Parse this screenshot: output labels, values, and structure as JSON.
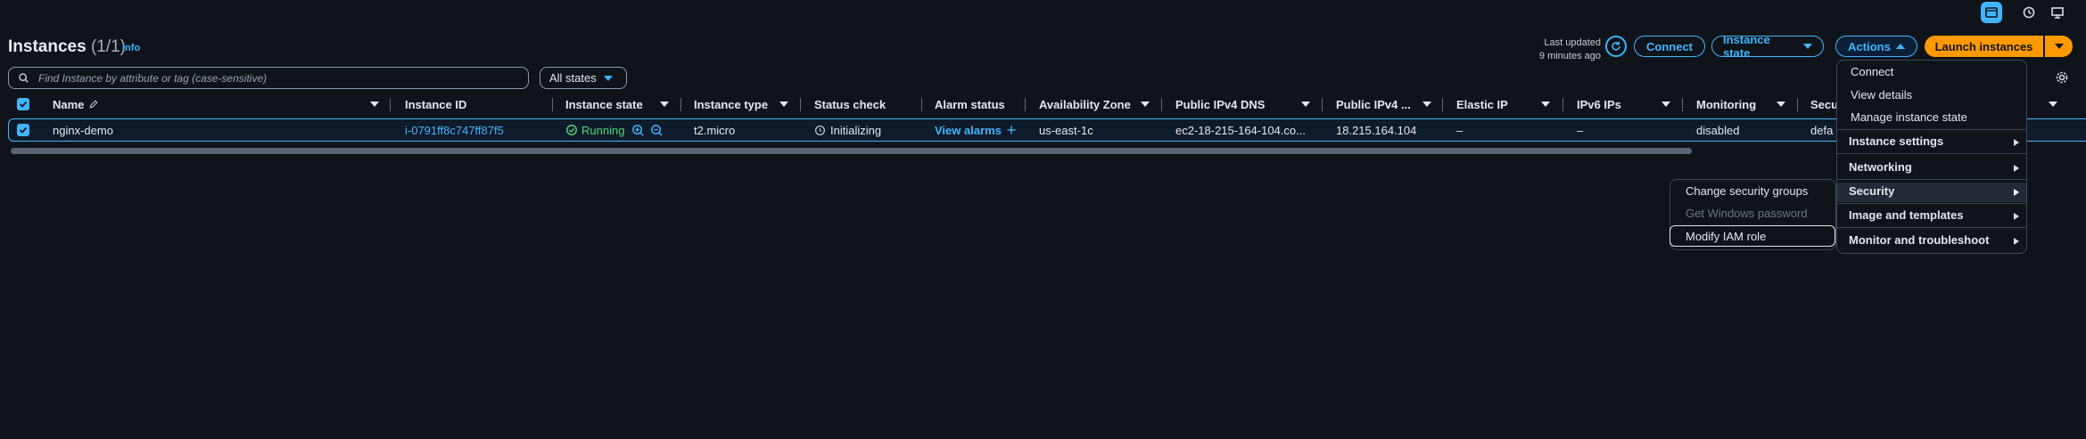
{
  "colors": {
    "accent": "#42b4ff",
    "primary_button": "#ff9900",
    "running": "#4fd672",
    "background": "#0f141a"
  },
  "topbar": {
    "icons": [
      "cloudshell-icon",
      "history-icon",
      "screen-icon"
    ]
  },
  "header": {
    "title": "Instances",
    "count": "(1/1)",
    "info": "Info",
    "last_updated_label": "Last updated",
    "last_updated_value": "9 minutes ago",
    "connect": "Connect",
    "instance_state": "Instance state",
    "actions": "Actions",
    "launch": "Launch instances"
  },
  "filters": {
    "search_placeholder": "Find Instance by attribute or tag (case-sensitive)",
    "state_filter": "All states"
  },
  "table": {
    "columns": [
      "Name",
      "Instance ID",
      "Instance state",
      "Instance type",
      "Status check",
      "Alarm status",
      "Availability Zone",
      "Public IPv4 DNS",
      "Public IPv4 ...",
      "Elastic IP",
      "IPv6 IPs",
      "Monitoring",
      "Secu"
    ],
    "rows": [
      {
        "name": "nginx-demo",
        "instance_id": "i-0791ff8c747ff87f5",
        "state": "Running",
        "type": "t2.micro",
        "status_check": "Initializing",
        "alarm": "View alarms",
        "az": "us-east-1c",
        "dns": "ec2-18-215-164-104.co...",
        "ipv4": "18.215.164.104",
        "elastic_ip": "–",
        "ipv6": "–",
        "monitoring": "disabled",
        "security": "defa"
      }
    ]
  },
  "actions_menu": {
    "items": [
      "Connect",
      "View details",
      "Manage instance state"
    ],
    "groups": [
      "Instance settings",
      "Networking",
      "Security",
      "Image and templates",
      "Monitor and troubleshoot"
    ]
  },
  "security_submenu": {
    "items": [
      "Change security groups",
      "Get Windows password",
      "Modify IAM role"
    ]
  }
}
